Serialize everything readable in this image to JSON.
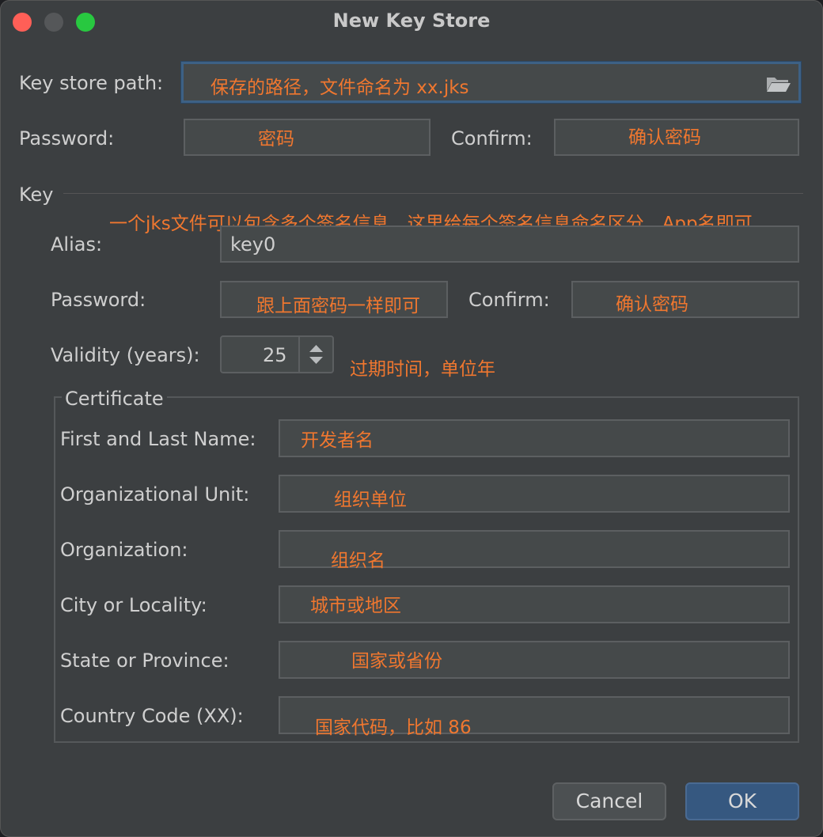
{
  "window": {
    "title": "New Key Store"
  },
  "keystore": {
    "path_label": "Key store path:",
    "path_note": "保存的路径，文件命名为 xx.jks",
    "password_label": "Password:",
    "password_note": "密码",
    "confirm_label": "Confirm:",
    "confirm_note": "确认密码"
  },
  "key": {
    "section_label": "Key",
    "alias_note": "一个jks文件可以包含多个签名信息，这里给每个签名信息命名区分，App名即可",
    "alias_label": "Alias:",
    "alias_value": "key0",
    "password_label": "Password:",
    "password_note": "跟上面密码一样即可",
    "confirm_label": "Confirm:",
    "confirm_note": "确认密码",
    "validity_label": "Validity (years):",
    "validity_value": "25",
    "validity_note": "过期时间，单位年"
  },
  "certificate": {
    "legend": "Certificate",
    "fields": [
      {
        "label": "First and Last Name:",
        "note": "开发者名"
      },
      {
        "label": "Organizational Unit:",
        "note": "组织单位"
      },
      {
        "label": "Organization:",
        "note": "组织名"
      },
      {
        "label": "City or Locality:",
        "note": "城市或地区"
      },
      {
        "label": "State or Province:",
        "note": "国家或省份"
      },
      {
        "label": "Country Code (XX):",
        "note": "国家代码，比如 86"
      }
    ]
  },
  "buttons": {
    "cancel": "Cancel",
    "ok": "OK"
  },
  "icons": {
    "browse": "folder-icon",
    "spinner": "up-down-arrows-icon"
  },
  "colors": {
    "annotation": "#f0772f",
    "ok_button": "#365880",
    "background": "#3c3f41"
  }
}
